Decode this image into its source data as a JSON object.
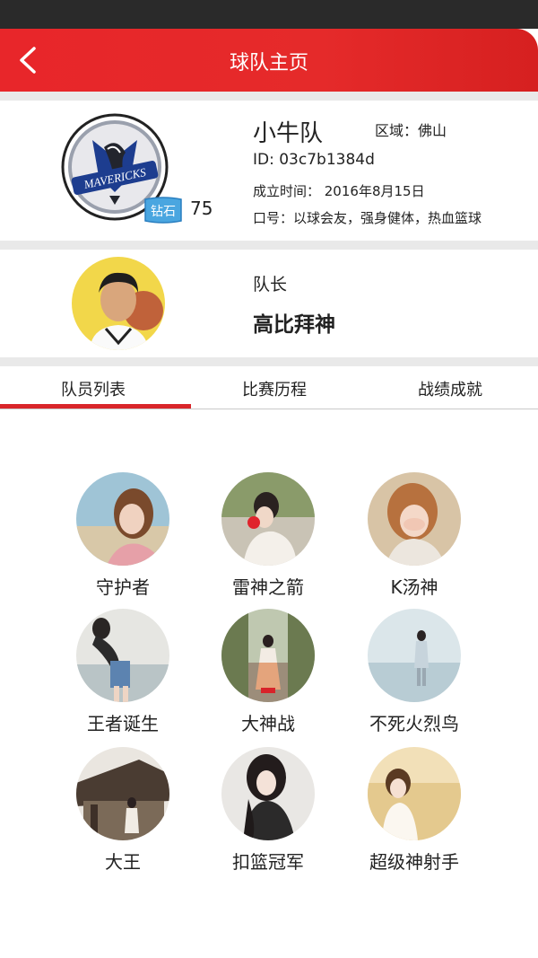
{
  "header": {
    "title": "球队主页",
    "back_icon": "chevron-left-icon"
  },
  "team": {
    "name": "小牛队",
    "region": "区域：佛山",
    "id": "ID: 03c7b1384d",
    "founded": "成立时间： 2016年8月15日",
    "slogan": "口号：以球会友，强身健体，热血篮球",
    "logo_text": "MAVERICKS",
    "level_badge": "钻石",
    "level_value": "75",
    "accent_color": "#e52a2a",
    "logo_blue": "#1d3d8f"
  },
  "captain": {
    "label": "队长",
    "name": "高比拜神"
  },
  "tabs": [
    {
      "label": "队员列表",
      "active": true
    },
    {
      "label": "比赛历程",
      "active": false
    },
    {
      "label": "战绩成就",
      "active": false
    }
  ],
  "members": [
    {
      "name": "守护者"
    },
    {
      "name": "雷神之箭"
    },
    {
      "name": "K汤神"
    },
    {
      "name": "王者诞生"
    },
    {
      "name": "大神战"
    },
    {
      "name": "不死火烈鸟"
    },
    {
      "name": "大王"
    },
    {
      "name": "扣篮冠军"
    },
    {
      "name": "超级神射手"
    }
  ]
}
